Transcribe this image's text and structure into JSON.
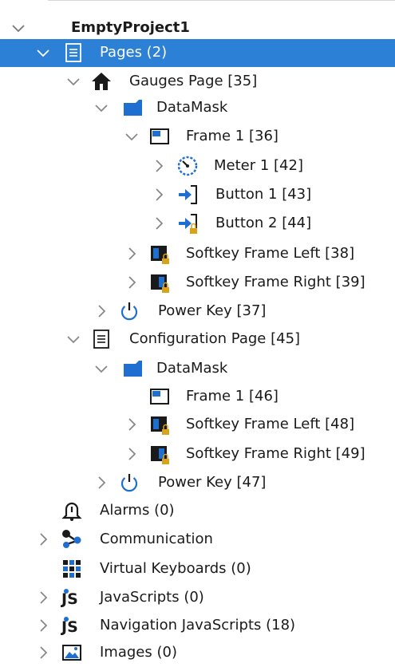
{
  "tree": {
    "project": "EmptyProject1",
    "pages": "Pages (2)",
    "gauges_page": "Gauges Page [35]",
    "gauges_datamask": "DataMask",
    "gauges_frame": "Frame 1 [36]",
    "meter": "Meter 1 [42]",
    "button1": "Button 1 [43]",
    "button2": "Button 2 [44]",
    "gauges_softkey_left": "Softkey Frame Left [38]",
    "gauges_softkey_right": "Softkey Frame Right [39]",
    "gauges_power_key": "Power Key [37]",
    "config_page": "Configuration Page [45]",
    "config_datamask": "DataMask",
    "config_frame": "Frame 1 [46]",
    "config_softkey_left": "Softkey Frame Left [48]",
    "config_softkey_right": "Softkey Frame Right [49]",
    "config_power_key": "Power Key [47]",
    "alarms": "Alarms (0)",
    "communication": "Communication",
    "virtual_keyboards": "Virtual Keyboards (0)",
    "javascripts": "JavaScripts (0)",
    "navigation_javascripts": "Navigation JavaScripts (18)",
    "images": "Images (0)"
  },
  "colors": {
    "selection": "#2c80d6",
    "accent_blue": "#1e6fd0",
    "lock_gold": "#d9a21b"
  }
}
